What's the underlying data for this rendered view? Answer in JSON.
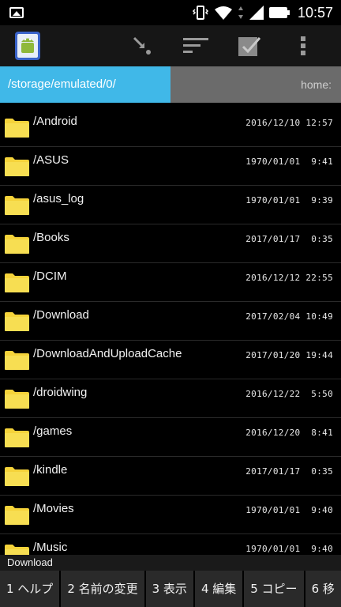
{
  "status": {
    "time": "10:57"
  },
  "path": {
    "current": "/storage/emulated/0/",
    "home": "home:"
  },
  "files": [
    {
      "name": "/Android",
      "date": "2016/12/10 12:57"
    },
    {
      "name": "/ASUS",
      "date": "1970/01/01  9:41"
    },
    {
      "name": "/asus_log",
      "date": "1970/01/01  9:39"
    },
    {
      "name": "/Books",
      "date": "2017/01/17  0:35"
    },
    {
      "name": "/DCIM",
      "date": "2016/12/12 22:55"
    },
    {
      "name": "/Download",
      "date": "2017/02/04 10:49"
    },
    {
      "name": "/DownloadAndUploadCache",
      "date": "2017/01/20 19:44"
    },
    {
      "name": "/droidwing",
      "date": "2016/12/22  5:50"
    },
    {
      "name": "/games",
      "date": "2016/12/20  8:41"
    },
    {
      "name": "/kindle",
      "date": "2017/01/17  0:35"
    },
    {
      "name": "/Movies",
      "date": "1970/01/01  9:40"
    },
    {
      "name": "/Music",
      "date": "1970/01/01  9:40"
    }
  ],
  "bottom_label": "Download",
  "fkeys": [
    "1 ヘルプ",
    "2 名前の変更",
    "3 表示",
    "4 編集",
    "5 コピー",
    "6 移"
  ],
  "colors": {
    "path_active": "#40b8e8",
    "path_inactive": "#6b6b6b",
    "folder": "#f5d33a"
  }
}
